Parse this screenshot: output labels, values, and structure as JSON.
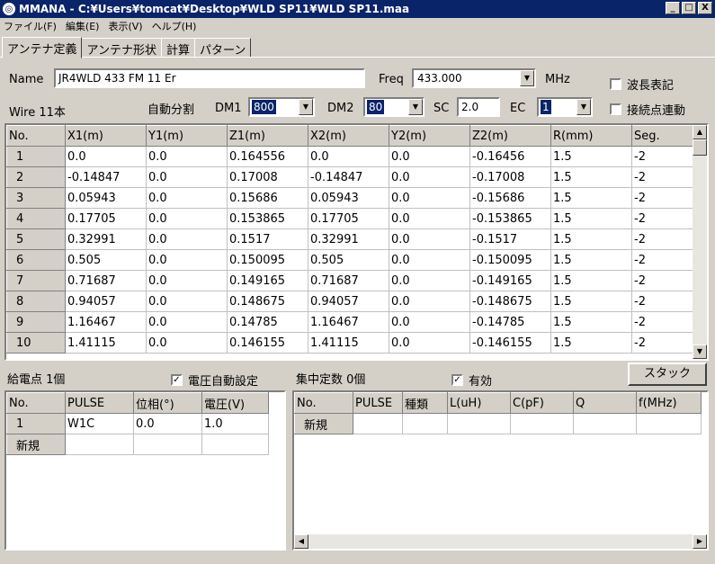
{
  "window": {
    "title": "MMANA - C:¥Users¥tomcat¥Desktop¥WLD SP11¥WLD SP11.maa",
    "minimize": "_",
    "maximize": "□",
    "close": "X"
  },
  "menu": [
    "ファイル(F)",
    "編集(E)",
    "表示(V)",
    "ヘルプ(H)"
  ],
  "tabs": [
    "アンテナ定義",
    "アンテナ形状",
    "計算",
    "パターン"
  ],
  "name_label": "Name",
  "name_value": "JR4WLD 433 FM 11 Er",
  "freq_label": "Freq",
  "freq_value": "433.000",
  "freq_unit": "MHz",
  "wavelength_check_label": "波長表記",
  "wire_count": "Wire 11本",
  "auto_split_label": "自動分割",
  "dm1_label": "DM1",
  "dm1_value": "800",
  "dm2_label": "DM2",
  "dm2_value": "80",
  "sc_label": "SC",
  "sc_value": "2.0",
  "ec_label": "EC",
  "ec_value": "1",
  "link_check_label": "接続点連動",
  "wire_table": {
    "headers": [
      "No.",
      "X1(m)",
      "Y1(m)",
      "Z1(m)",
      "X2(m)",
      "Y2(m)",
      "Z2(m)",
      "R(mm)",
      "Seg."
    ],
    "rows": [
      [
        "1",
        "0.0",
        "0.0",
        "0.164556",
        "0.0",
        "0.0",
        "-0.16456",
        "1.5",
        "-2"
      ],
      [
        "2",
        "-0.14847",
        "0.0",
        "0.17008",
        "-0.14847",
        "0.0",
        "-0.17008",
        "1.5",
        "-2"
      ],
      [
        "3",
        "0.05943",
        "0.0",
        "0.15686",
        "0.05943",
        "0.0",
        "-0.15686",
        "1.5",
        "-2"
      ],
      [
        "4",
        "0.17705",
        "0.0",
        "0.153865",
        "0.17705",
        "0.0",
        "-0.153865",
        "1.5",
        "-2"
      ],
      [
        "5",
        "0.32991",
        "0.0",
        "0.1517",
        "0.32991",
        "0.0",
        "-0.1517",
        "1.5",
        "-2"
      ],
      [
        "6",
        "0.505",
        "0.0",
        "0.150095",
        "0.505",
        "0.0",
        "-0.150095",
        "1.5",
        "-2"
      ],
      [
        "7",
        "0.71687",
        "0.0",
        "0.149165",
        "0.71687",
        "0.0",
        "-0.149165",
        "1.5",
        "-2"
      ],
      [
        "8",
        "0.94057",
        "0.0",
        "0.148675",
        "0.94057",
        "0.0",
        "-0.148675",
        "1.5",
        "-2"
      ],
      [
        "9",
        "1.16467",
        "0.0",
        "0.14785",
        "1.16467",
        "0.0",
        "-0.14785",
        "1.5",
        "-2"
      ],
      [
        "10",
        "1.41115",
        "0.0",
        "0.146155",
        "1.41115",
        "0.0",
        "-0.146155",
        "1.5",
        "-2"
      ]
    ]
  },
  "feed_label": "給電点 1個",
  "auto_voltage_label": "電圧自動設定",
  "lumped_label": "集中定数 0個",
  "valid_label": "有効",
  "stack_button": "スタック",
  "feed_table": {
    "headers": [
      "No.",
      "PULSE",
      "位相(°)",
      "電圧(V)"
    ],
    "rows": [
      [
        "1",
        "W1C",
        "0.0",
        "1.0"
      ],
      [
        "新規",
        "",
        "",
        ""
      ]
    ]
  },
  "lumped_table": {
    "headers": [
      "No.",
      "PULSE",
      "種類",
      "L(uH)",
      "C(pF)",
      "Q",
      "f(MHz)"
    ],
    "rows": [
      [
        "新規",
        "",
        "",
        "",
        "",
        "",
        ""
      ]
    ]
  }
}
